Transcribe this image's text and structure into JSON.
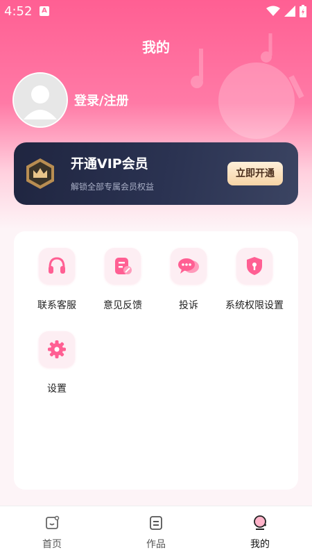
{
  "status_bar": {
    "time": "4:52",
    "badge": "A"
  },
  "page": {
    "title": "我的"
  },
  "profile": {
    "login_text": "登录/注册"
  },
  "vip": {
    "title": "开通VIP会员",
    "subtitle": "解锁全部专属会员权益",
    "button": "立即开通"
  },
  "menu": {
    "items": [
      {
        "label": "联系客服",
        "icon": "headset-icon"
      },
      {
        "label": "意见反馈",
        "icon": "feedback-icon"
      },
      {
        "label": "投诉",
        "icon": "chat-bubble-icon"
      },
      {
        "label": "系统权限设置",
        "icon": "shield-icon"
      },
      {
        "label": "设置",
        "icon": "gear-icon"
      }
    ]
  },
  "tabbar": {
    "tabs": [
      {
        "label": "首页",
        "icon": "home-icon"
      },
      {
        "label": "作品",
        "icon": "works-icon"
      },
      {
        "label": "我的",
        "icon": "profile-icon",
        "active": true
      }
    ]
  },
  "colors": {
    "accent": "#ff5f93",
    "vip_bg": "#1f2540",
    "vip_button": "#f6d4a6"
  }
}
